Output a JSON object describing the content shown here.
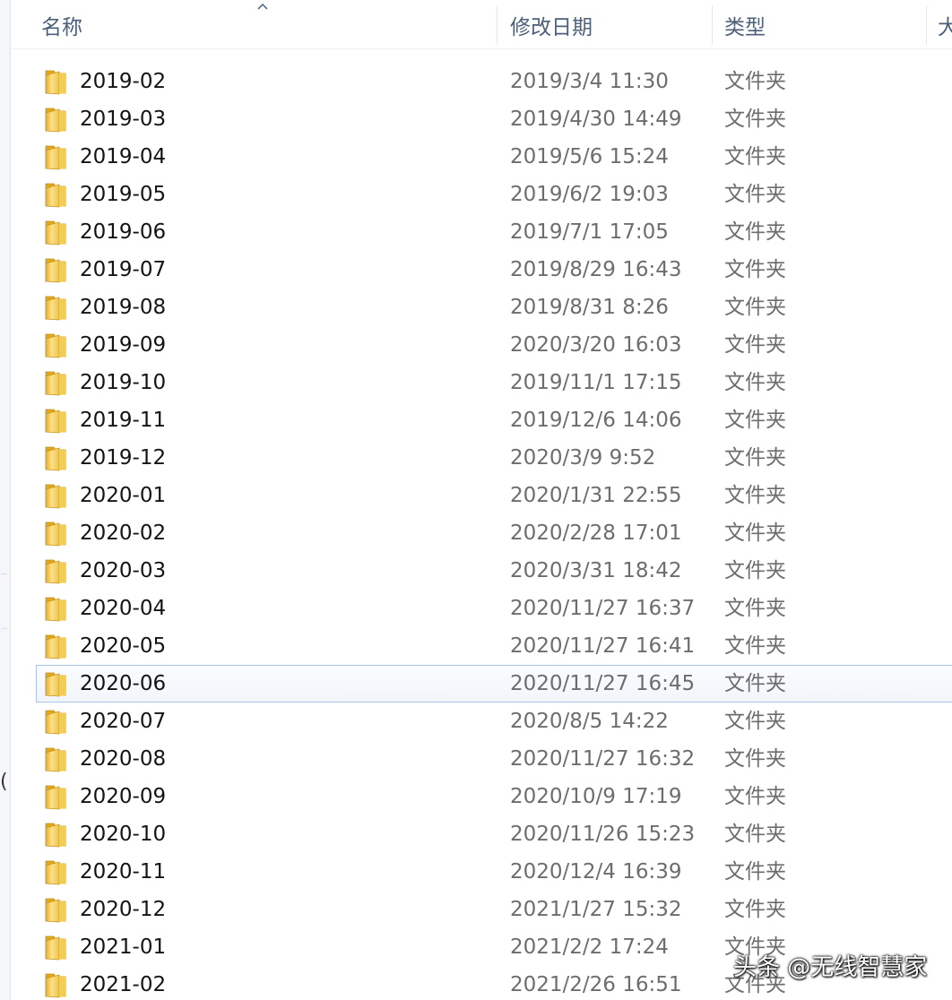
{
  "columns": {
    "name": "名称",
    "date": "修改日期",
    "type": "类型",
    "size": "大"
  },
  "rows": [
    {
      "name": "2019-02",
      "date": "2019/3/4 11:30",
      "type": "文件夹"
    },
    {
      "name": "2019-03",
      "date": "2019/4/30 14:49",
      "type": "文件夹"
    },
    {
      "name": "2019-04",
      "date": "2019/5/6 15:24",
      "type": "文件夹"
    },
    {
      "name": "2019-05",
      "date": "2019/6/2 19:03",
      "type": "文件夹"
    },
    {
      "name": "2019-06",
      "date": "2019/7/1 17:05",
      "type": "文件夹"
    },
    {
      "name": "2019-07",
      "date": "2019/8/29 16:43",
      "type": "文件夹"
    },
    {
      "name": "2019-08",
      "date": "2019/8/31 8:26",
      "type": "文件夹"
    },
    {
      "name": "2019-09",
      "date": "2020/3/20 16:03",
      "type": "文件夹"
    },
    {
      "name": "2019-10",
      "date": "2019/11/1 17:15",
      "type": "文件夹"
    },
    {
      "name": "2019-11",
      "date": "2019/12/6 14:06",
      "type": "文件夹"
    },
    {
      "name": "2019-12",
      "date": "2020/3/9 9:52",
      "type": "文件夹"
    },
    {
      "name": "2020-01",
      "date": "2020/1/31 22:55",
      "type": "文件夹"
    },
    {
      "name": "2020-02",
      "date": "2020/2/28 17:01",
      "type": "文件夹"
    },
    {
      "name": "2020-03",
      "date": "2020/3/31 18:42",
      "type": "文件夹"
    },
    {
      "name": "2020-04",
      "date": "2020/11/27 16:37",
      "type": "文件夹"
    },
    {
      "name": "2020-05",
      "date": "2020/11/27 16:41",
      "type": "文件夹"
    },
    {
      "name": "2020-06",
      "date": "2020/11/27 16:45",
      "type": "文件夹",
      "selected": true
    },
    {
      "name": "2020-07",
      "date": "2020/8/5 14:22",
      "type": "文件夹"
    },
    {
      "name": "2020-08",
      "date": "2020/11/27 16:32",
      "type": "文件夹"
    },
    {
      "name": "2020-09",
      "date": "2020/10/9 17:19",
      "type": "文件夹"
    },
    {
      "name": "2020-10",
      "date": "2020/11/26 15:23",
      "type": "文件夹"
    },
    {
      "name": "2020-11",
      "date": "2020/12/4 16:39",
      "type": "文件夹"
    },
    {
      "name": "2020-12",
      "date": "2021/1/27 15:32",
      "type": "文件夹"
    },
    {
      "name": "2021-01",
      "date": "2021/2/2 17:24",
      "type": "文件夹"
    },
    {
      "name": "2021-02",
      "date": "2021/2/26 16:51",
      "type": "文件夹"
    }
  ],
  "watermark": "头条 @无线智慧家",
  "colors": {
    "header_text": "#4c607a",
    "selection_border": "#a9c3e4",
    "folder_yellow": "#f2c744"
  },
  "icons": {
    "folder": "folder-icon",
    "sort": "sort-ascending-icon"
  }
}
